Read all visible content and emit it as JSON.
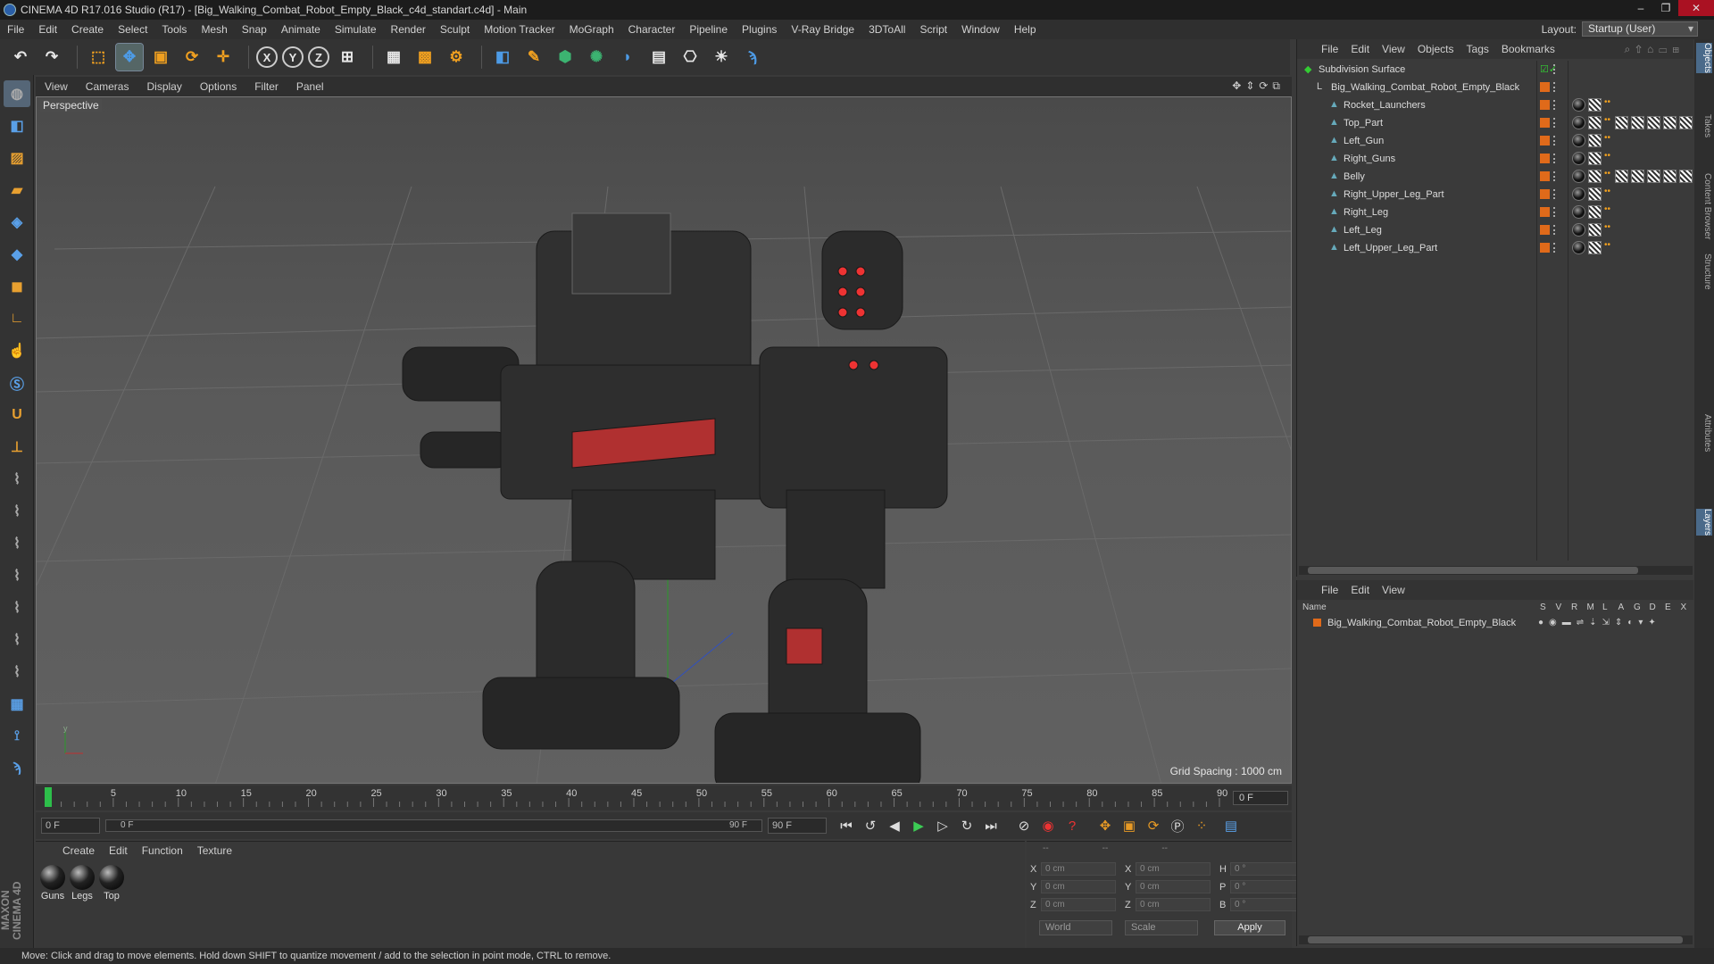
{
  "window": {
    "title": "CINEMA 4D R17.016 Studio (R17) - [Big_Walking_Combat_Robot_Empty_Black_c4d_standart.c4d] - Main"
  },
  "menu": [
    "File",
    "Edit",
    "Create",
    "Select",
    "Tools",
    "Mesh",
    "Snap",
    "Animate",
    "Simulate",
    "Render",
    "Sculpt",
    "Motion Tracker",
    "MoGraph",
    "Character",
    "Pipeline",
    "Plugins",
    "V-Ray Bridge",
    "3DToAll",
    "Script",
    "Window",
    "Help"
  ],
  "layout": {
    "label": "Layout:",
    "value": "Startup (User)"
  },
  "toolbar": {
    "icons": [
      "undo-icon",
      "redo-icon",
      "live-selection-icon",
      "move-icon",
      "scale-icon",
      "rotate-icon",
      "transform-icon",
      "x-axis-icon",
      "y-axis-icon",
      "z-axis-icon",
      "coordinate-system-icon",
      "render-view-icon",
      "render-picture-viewer-icon",
      "render-settings-icon",
      "cube-icon",
      "pen-icon",
      "subdivision-icon",
      "mograph-cloner-icon",
      "deformer-icon",
      "floor-icon",
      "camera-icon",
      "light-icon",
      "python-icon"
    ],
    "axis": [
      "X",
      "Y",
      "Z"
    ]
  },
  "viewport": {
    "menu": [
      "View",
      "Cameras",
      "Display",
      "Options",
      "Filter",
      "Panel"
    ],
    "label": "Perspective",
    "grid_spacing": "Grid Spacing : 1000 cm"
  },
  "timeline": {
    "ticks": [
      "0",
      "5",
      "10",
      "15",
      "20",
      "25",
      "30",
      "35",
      "40",
      "45",
      "50",
      "55",
      "60",
      "65",
      "70",
      "75",
      "80",
      "85",
      "90"
    ],
    "current_frame": "0 F"
  },
  "playback": {
    "start": "0 F",
    "range_start": "0 F",
    "range_end": "90 F",
    "end": "90 F"
  },
  "materials": {
    "menu": [
      "Create",
      "Edit",
      "Function",
      "Texture"
    ],
    "items": [
      "Guns",
      "Legs",
      "Top"
    ]
  },
  "coordinates": {
    "rows": [
      {
        "a": "X",
        "av": "0 cm",
        "b": "X",
        "bv": "0 cm",
        "c": "H",
        "cv": "0 °"
      },
      {
        "a": "Y",
        "av": "0 cm",
        "b": "Y",
        "bv": "0 cm",
        "c": "P",
        "cv": "0 °"
      },
      {
        "a": "Z",
        "av": "0 cm",
        "b": "Z",
        "bv": "0 cm",
        "c": "B",
        "cv": "0 °"
      }
    ],
    "dash1": "--",
    "dash2": "--",
    "dash3": "--",
    "world": "World",
    "scale": "Scale",
    "apply": "Apply"
  },
  "objects": {
    "menu": [
      "File",
      "Edit",
      "View",
      "Objects",
      "Tags",
      "Bookmarks"
    ],
    "tree": [
      {
        "name": "Subdivision Surface",
        "indent": 0,
        "mats": "none"
      },
      {
        "name": "Big_Walking_Combat_Robot_Empty_Black",
        "indent": 1,
        "mats": "none"
      },
      {
        "name": "Rocket_Launchers",
        "indent": 2,
        "mats": "short"
      },
      {
        "name": "Top_Part",
        "indent": 2,
        "mats": "long"
      },
      {
        "name": "Left_Gun",
        "indent": 2,
        "mats": "short"
      },
      {
        "name": "Right_Guns",
        "indent": 2,
        "mats": "short"
      },
      {
        "name": "Belly",
        "indent": 2,
        "mats": "long"
      },
      {
        "name": "Right_Upper_Leg_Part",
        "indent": 2,
        "mats": "short"
      },
      {
        "name": "Right_Leg",
        "indent": 2,
        "mats": "short"
      },
      {
        "name": "Left_Leg",
        "indent": 2,
        "mats": "short"
      },
      {
        "name": "Left_Upper_Leg_Part",
        "indent": 2,
        "mats": "short"
      }
    ]
  },
  "layers": {
    "menu": [
      "File",
      "Edit",
      "View"
    ],
    "col_name": "Name",
    "cols": [
      "S",
      "V",
      "R",
      "M",
      "L",
      "A",
      "G",
      "D",
      "E",
      "X"
    ],
    "row": "Big_Walking_Combat_Robot_Empty_Black"
  },
  "right_tabs": [
    "Objects",
    "Takes",
    "Content Browser",
    "Structure",
    "Attributes",
    "Layers"
  ],
  "status": "Move: Click and drag to move elements. Hold down SHIFT to quantize movement / add to the selection in point mode, CTRL to remove.",
  "brand": "MAXON CINEMA 4D"
}
